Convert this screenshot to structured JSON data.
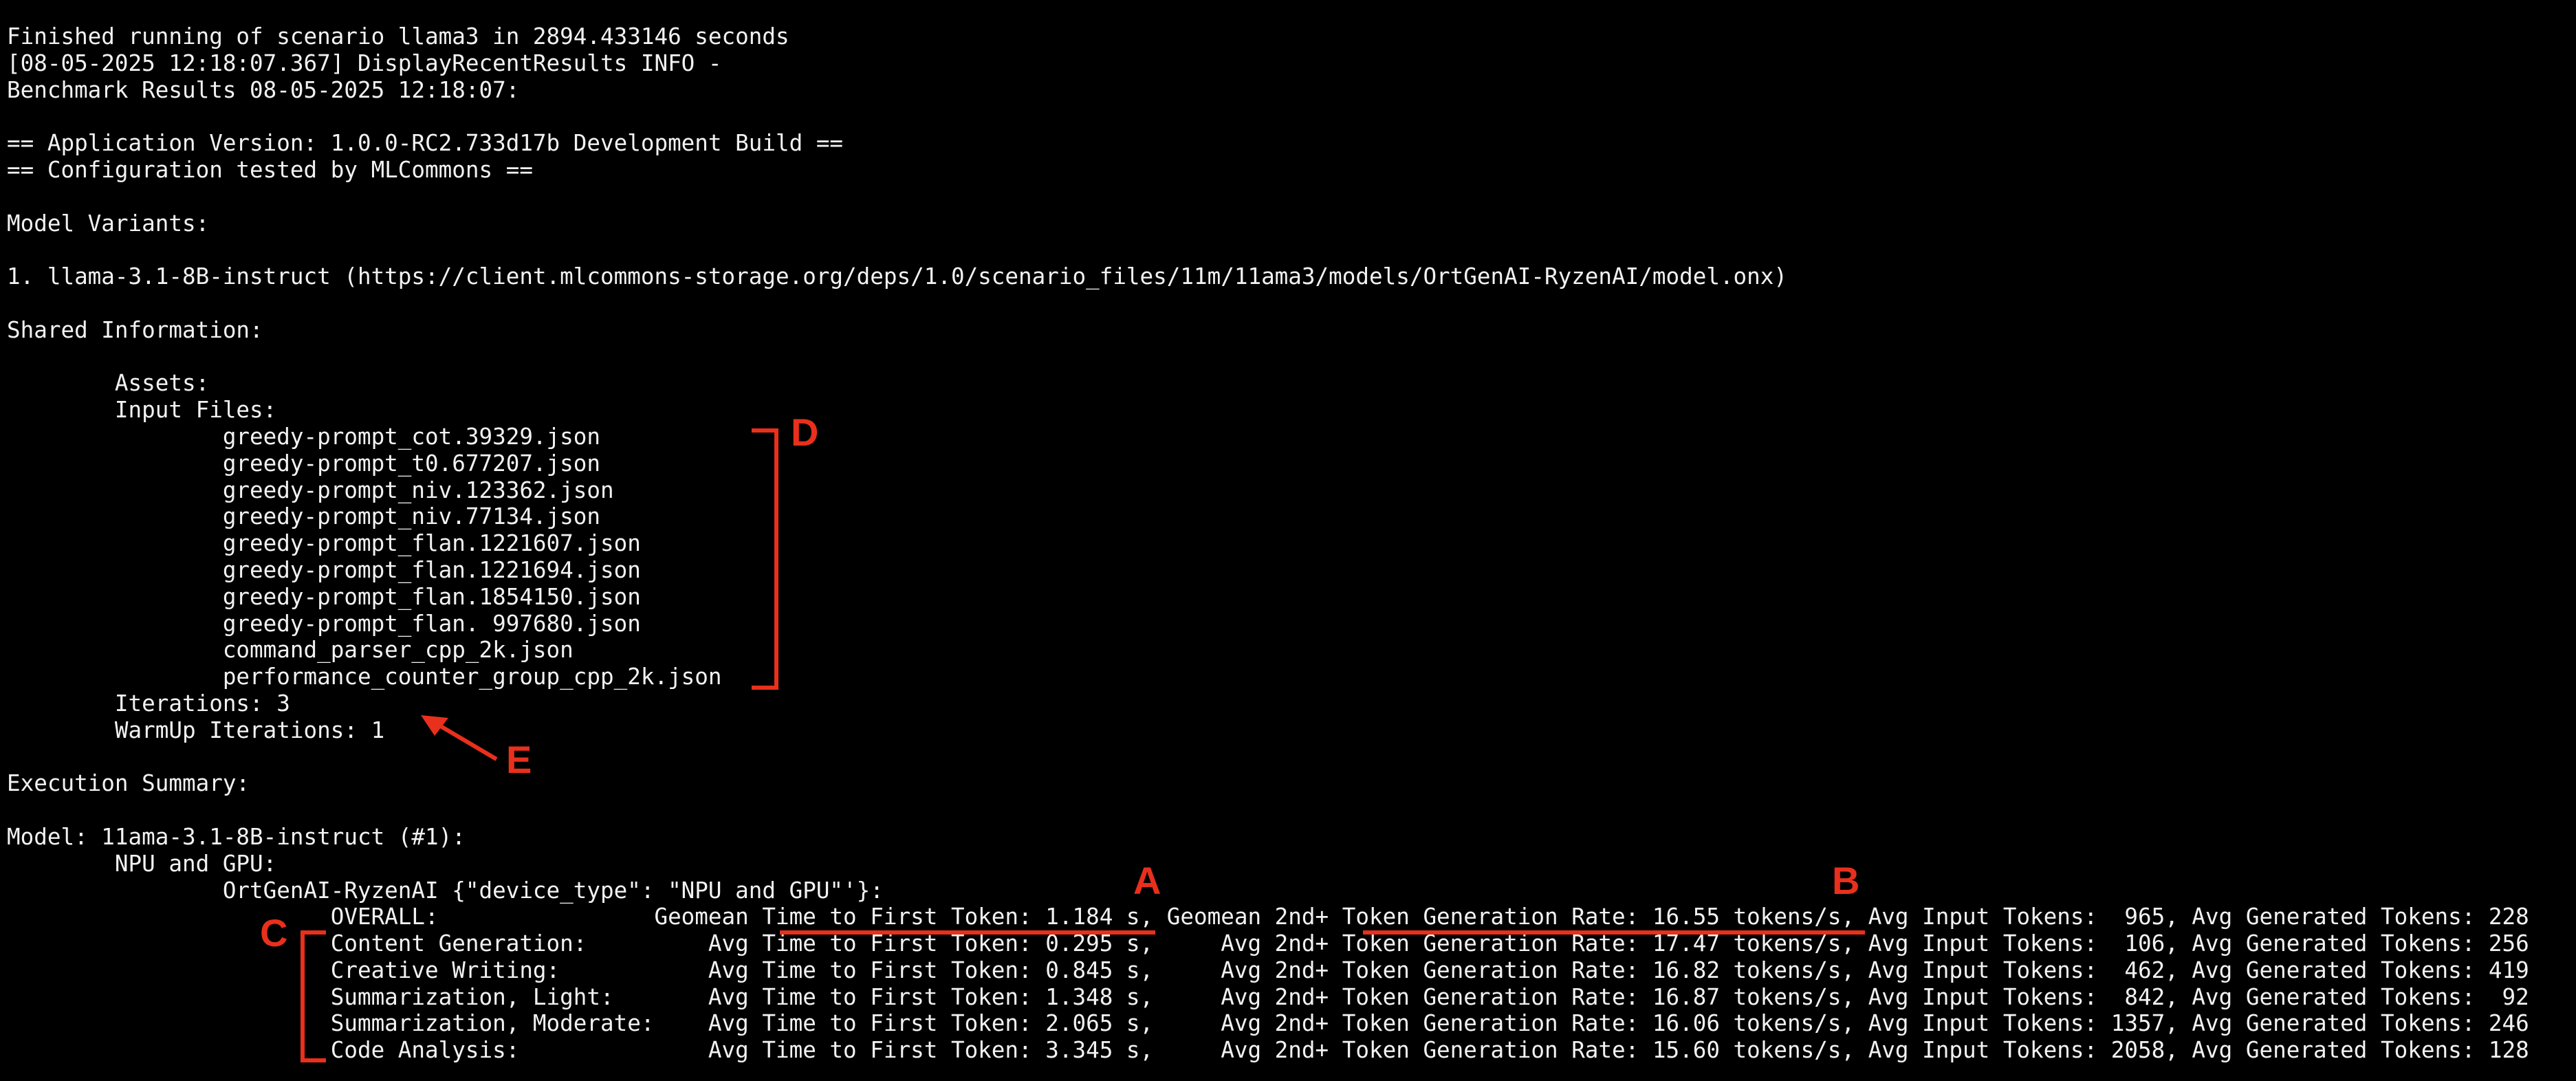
{
  "terminal": {
    "lines": [
      "Finished running of scenario llama3 in 2894.433146 seconds",
      "[08-05-2025 12:18:07.367] DisplayRecentResults INFO -",
      "Benchmark Results 08-05-2025 12:18:07:",
      "",
      "== Application Version: 1.0.0-RC2.733d17b Development Build ==",
      "== Configuration tested by MLCommons ==",
      "",
      "Model Variants:",
      "",
      "1. llama-3.1-8B-instruct (https://client.mlcommons-storage.org/deps/1.0/scenario_files/11m/11ama3/models/OrtGenAI-RyzenAI/model.onx)",
      "",
      "Shared Information:",
      "",
      "        Assets:",
      "        Input Files:",
      "                greedy-prompt_cot.39329.json",
      "                greedy-prompt_t0.677207.json",
      "                greedy-prompt_niv.123362.json",
      "                greedy-prompt_niv.77134.json",
      "                greedy-prompt_flan.1221607.json",
      "                greedy-prompt_flan.1221694.json",
      "                greedy-prompt_flan.1854150.json",
      "                greedy-prompt_flan. 997680.json",
      "                command_parser_cpp_2k.json",
      "                performance_counter_group_cpp_2k.json",
      "        Iterations: 3",
      "        WarmUp Iterations: 1",
      "",
      "Execution Summary:",
      "",
      "Model: 11ama-3.1-8B-instruct (#1):",
      "        NPU and GPU:",
      "                OrtGenAI-RyzenAI {\"device_type\": \"NPU and GPU\"'}:",
      "                        OVERALL:                Geomean Time to First Token: 1.184 s, Geomean 2nd+ Token Generation Rate: 16.55 tokens/s, Avg Input Tokens:  965, Avg Generated Tokens: 228",
      "                        Content Generation:         Avg Time to First Token: 0.295 s,     Avg 2nd+ Token Generation Rate: 17.47 tokens/s, Avg Input Tokens:  106, Avg Generated Tokens: 256",
      "                        Creative Writing:           Avg Time to First Token: 0.845 s,     Avg 2nd+ Token Generation Rate: 16.82 tokens/s, Avg Input Tokens:  462, Avg Generated Tokens: 419",
      "                        Summarization, Light:       Avg Time to First Token: 1.348 s,     Avg 2nd+ Token Generation Rate: 16.87 tokens/s, Avg Input Tokens:  842, Avg Generated Tokens:  92",
      "                        Summarization, Moderate:    Avg Time to First Token: 2.065 s,     Avg 2nd+ Token Generation Rate: 16.06 tokens/s, Avg Input Tokens: 1357, Avg Generated Tokens: 246",
      "                        Code Analysis:              Avg Time to First Token: 3.345 s,     Avg 2nd+ Token Generation Rate: 15.60 tokens/s, Avg Input Tokens: 2058, Avg Generated Tokens: 128"
    ]
  },
  "annotations": {
    "color": "#e8301c",
    "labels": {
      "A": "A",
      "B": "B",
      "C": "C",
      "D": "D",
      "E": "E"
    }
  },
  "colors": {
    "background": "#000000",
    "text": "#f2f2f2",
    "annotation": "#e8301c"
  }
}
